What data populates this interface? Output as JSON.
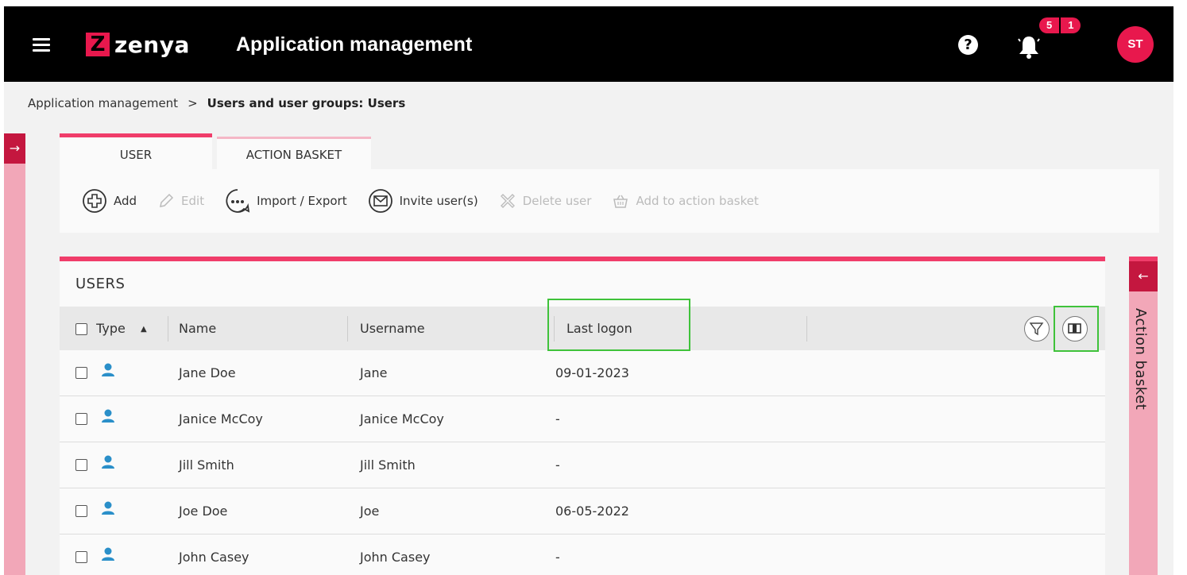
{
  "header": {
    "brand_mark": "Z",
    "brand_name": "zenya",
    "title": "Application management",
    "help_label": "?",
    "notifications": {
      "count_a": "5",
      "count_b": "1"
    },
    "avatar_initials": "ST"
  },
  "breadcrumb": {
    "root": "Application management",
    "separator": ">",
    "current": "Users and user groups: Users"
  },
  "left_panel": {
    "arrow": "→"
  },
  "tabs": [
    {
      "label": "USER",
      "active": true
    },
    {
      "label": "ACTION BASKET",
      "active": false
    }
  ],
  "toolbar": {
    "add": "Add",
    "edit": "Edit",
    "import_export": "Import / Export",
    "invite": "Invite user(s)",
    "delete": "Delete user",
    "add_to_basket": "Add to action basket"
  },
  "users": {
    "title": "USERS",
    "columns": {
      "type": "Type",
      "name": "Name",
      "username": "Username",
      "last_logon": "Last logon"
    },
    "rows": [
      {
        "name": "Jane Doe",
        "username": "Jane",
        "last_logon": "09-01-2023"
      },
      {
        "name": "Janice McCoy",
        "username": "Janice McCoy",
        "last_logon": "-"
      },
      {
        "name": "Jill Smith",
        "username": "Jill Smith",
        "last_logon": "-"
      },
      {
        "name": "Joe Doe",
        "username": "Joe",
        "last_logon": "06-05-2022"
      },
      {
        "name": "John Casey",
        "username": "John Casey",
        "last_logon": "-"
      }
    ]
  },
  "action_basket": {
    "arrow": "←",
    "label": "Action basket"
  },
  "colors": {
    "accent": "#f03d6a",
    "brand": "#e8184d",
    "dark_accent": "#c4173f",
    "side_panel": "#f2a7b8",
    "user_icon": "#2a8fc9",
    "highlight": "#3fc23a"
  }
}
